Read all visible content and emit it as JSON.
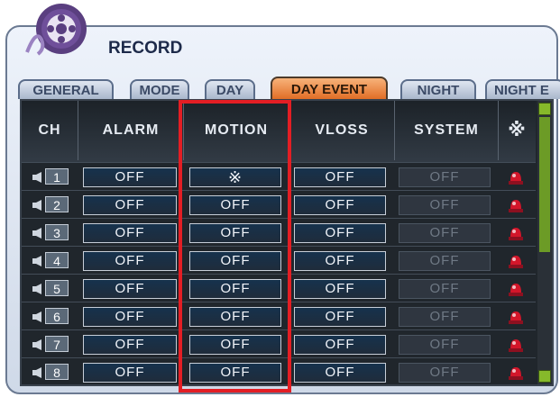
{
  "window": {
    "title": "RECORD"
  },
  "tabs": [
    {
      "label": "GENERAL",
      "active": false
    },
    {
      "label": "MODE",
      "active": false
    },
    {
      "label": "DAY",
      "active": false
    },
    {
      "label": "DAY EVENT",
      "active": true
    },
    {
      "label": "NIGHT",
      "active": false
    },
    {
      "label": "NIGHT E",
      "active": false
    }
  ],
  "columns": [
    "CH",
    "ALARM",
    "MOTION",
    "VLOSS",
    "SYSTEM",
    "※"
  ],
  "rows": [
    {
      "ch": "1",
      "alarm": "OFF",
      "motion": "※",
      "vloss": "OFF",
      "system": "OFF"
    },
    {
      "ch": "2",
      "alarm": "OFF",
      "motion": "OFF",
      "vloss": "OFF",
      "system": "OFF"
    },
    {
      "ch": "3",
      "alarm": "OFF",
      "motion": "OFF",
      "vloss": "OFF",
      "system": "OFF"
    },
    {
      "ch": "4",
      "alarm": "OFF",
      "motion": "OFF",
      "vloss": "OFF",
      "system": "OFF"
    },
    {
      "ch": "5",
      "alarm": "OFF",
      "motion": "OFF",
      "vloss": "OFF",
      "system": "OFF"
    },
    {
      "ch": "6",
      "alarm": "OFF",
      "motion": "OFF",
      "vloss": "OFF",
      "system": "OFF"
    },
    {
      "ch": "7",
      "alarm": "OFF",
      "motion": "OFF",
      "vloss": "OFF",
      "system": "OFF"
    },
    {
      "ch": "8",
      "alarm": "OFF",
      "motion": "OFF",
      "vloss": "OFF",
      "system": "OFF"
    }
  ],
  "colors": {
    "active_tab": "#e06a22",
    "highlight": "#e31e24",
    "scrollbar": "#86b92a",
    "alarm_icon": "#d3162a"
  },
  "icons": {
    "logo": "film-reel-icon",
    "channel": "speaker-icon",
    "alarm": "alarm-beacon-icon",
    "scroll_up": "scroll-up-arrow-icon",
    "scroll_down": "scroll-down-arrow-icon"
  }
}
